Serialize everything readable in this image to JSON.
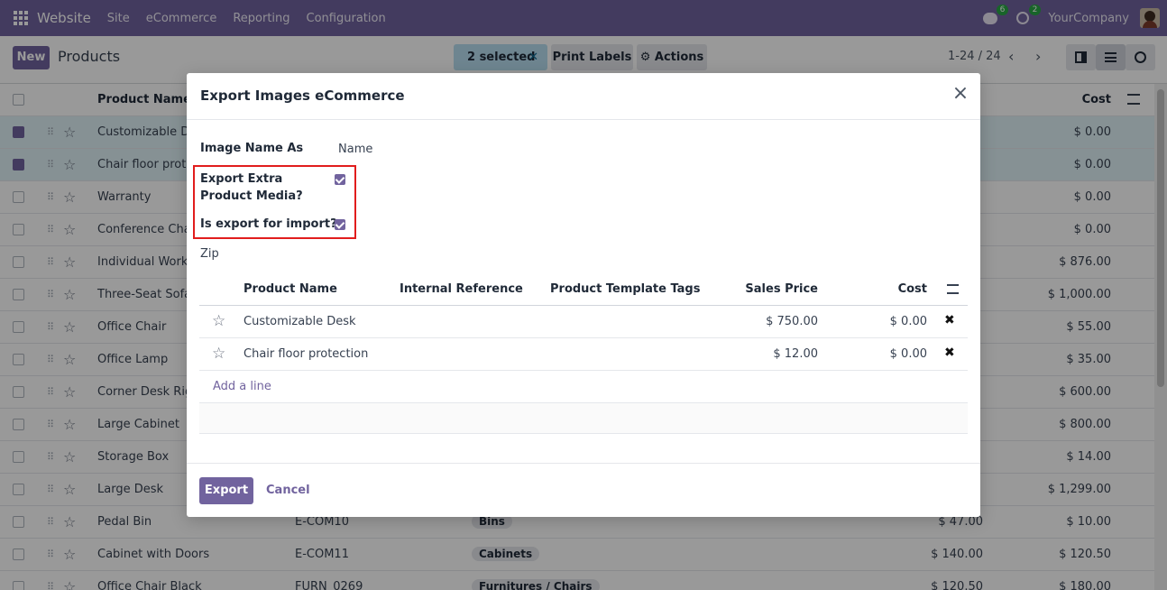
{
  "navbar": {
    "app_name": "Website",
    "menu": [
      "Site",
      "eCommerce",
      "Reporting",
      "Configuration"
    ],
    "chat_count": "6",
    "activity_count": "2",
    "company": "YourCompany"
  },
  "control": {
    "new_label": "New",
    "title": "Products",
    "selected_label": "2 selected",
    "print_labels": "Print Labels",
    "actions": "Actions",
    "pager": "1-24 / 24"
  },
  "list": {
    "headers": {
      "product_name": "Product Name",
      "cost": "Cost"
    },
    "rows": [
      {
        "name": "Customizable Des",
        "ref": "",
        "tag": "",
        "price": "",
        "cost": "$ 0.00",
        "selected": true
      },
      {
        "name": "Chair floor protec",
        "ref": "",
        "tag": "",
        "price": "",
        "cost": "$ 0.00",
        "selected": true
      },
      {
        "name": "Warranty",
        "ref": "",
        "tag": "",
        "price": "",
        "cost": "$ 0.00",
        "selected": false
      },
      {
        "name": "Conference Chair",
        "ref": "",
        "tag": "",
        "price": "",
        "cost": "$ 0.00",
        "selected": false
      },
      {
        "name": "Individual Workpl",
        "ref": "",
        "tag": "",
        "price": "",
        "cost": "$ 876.00",
        "selected": false
      },
      {
        "name": "Three-Seat Sofa",
        "ref": "",
        "tag": "",
        "price": "",
        "cost": "$ 1,000.00",
        "selected": false
      },
      {
        "name": "Office Chair",
        "ref": "",
        "tag": "",
        "price": "",
        "cost": "$ 55.00",
        "selected": false
      },
      {
        "name": "Office Lamp",
        "ref": "",
        "tag": "",
        "price": "",
        "cost": "$ 35.00",
        "selected": false
      },
      {
        "name": "Corner Desk Righ",
        "ref": "",
        "tag": "",
        "price": "",
        "cost": "$ 600.00",
        "selected": false
      },
      {
        "name": "Large Cabinet",
        "ref": "",
        "tag": "",
        "price": "",
        "cost": "$ 800.00",
        "selected": false
      },
      {
        "name": "Storage Box",
        "ref": "",
        "tag": "",
        "price": "",
        "cost": "$ 14.00",
        "selected": false
      },
      {
        "name": "Large Desk",
        "ref": "",
        "tag": "",
        "price": "",
        "cost": "$ 1,299.00",
        "selected": false
      },
      {
        "name": "Pedal Bin",
        "ref": "E-COM10",
        "tag": "Bins",
        "price": "$ 47.00",
        "cost": "$ 10.00",
        "selected": false
      },
      {
        "name": "Cabinet with Doors",
        "ref": "E-COM11",
        "tag": "Cabinets",
        "price": "$ 140.00",
        "cost": "$ 120.50",
        "selected": false
      },
      {
        "name": "Office Chair Black",
        "ref": "FURN_0269",
        "tag": "Furnitures / Chairs",
        "price": "$ 120.50",
        "cost": "$ 180.00",
        "selected": false
      }
    ]
  },
  "modal": {
    "title": "Export Images eCommerce",
    "image_name_label": "Image Name As",
    "image_name_value": "Name",
    "extra_media_label": "Export Extra Product Media?",
    "import_label": "Is export for import?",
    "zip_label": "Zip",
    "table": {
      "headers": [
        "Product Name",
        "Internal Reference",
        "Product Template Tags",
        "Sales Price",
        "Cost"
      ],
      "rows": [
        {
          "name": "Customizable Desk",
          "price": "$ 750.00",
          "cost": "$ 0.00"
        },
        {
          "name": "Chair floor protection",
          "price": "$ 12.00",
          "cost": "$ 0.00"
        }
      ],
      "add_line": "Add a line"
    },
    "export_label": "Export",
    "cancel_label": "Cancel"
  }
}
